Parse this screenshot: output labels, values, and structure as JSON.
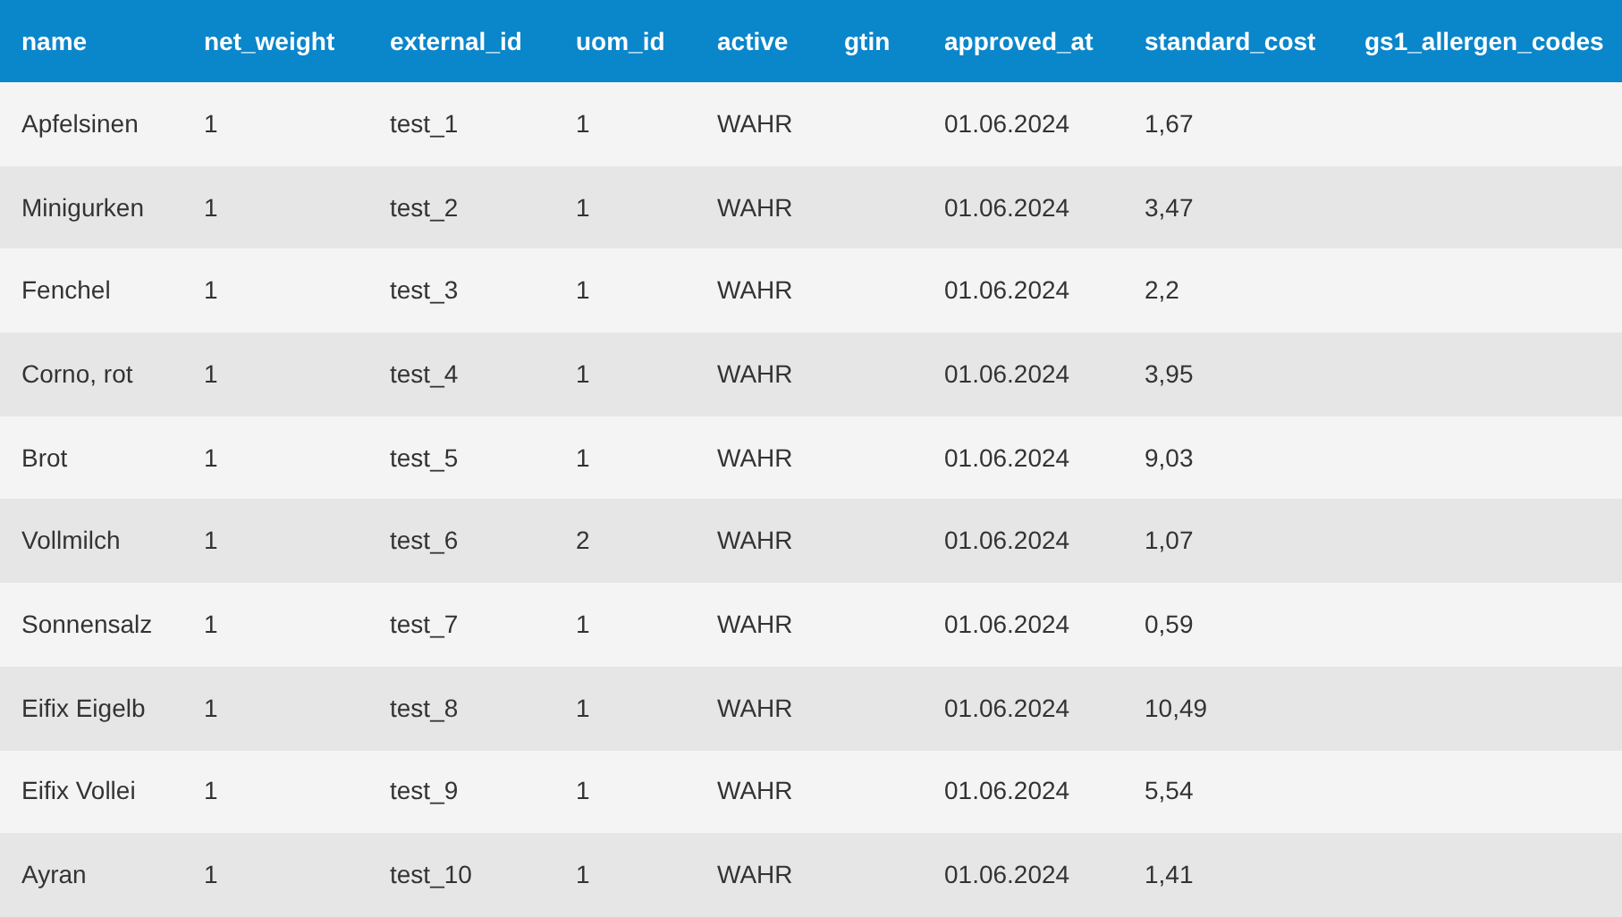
{
  "table": {
    "columns": [
      "name",
      "net_weight",
      "external_id",
      "uom_id",
      "active",
      "gtin",
      "approved_at",
      "standard_cost",
      "gs1_allergen_codes"
    ],
    "rows": [
      {
        "cells": [
          "Apfelsinen",
          "1",
          "test_1",
          "1",
          "WAHR",
          null,
          "01.06.2024",
          "1,67",
          null
        ]
      },
      {
        "cells": [
          "Minigurken",
          "1",
          "test_2",
          "1",
          "WAHR",
          null,
          "01.06.2024",
          "3,47",
          null
        ]
      },
      {
        "cells": [
          "Fenchel",
          "1",
          "test_3",
          "1",
          "WAHR",
          null,
          "01.06.2024",
          "2,2",
          null
        ]
      },
      {
        "cells": [
          "Corno, rot",
          "1",
          "test_4",
          "1",
          "WAHR",
          null,
          "01.06.2024",
          "3,95",
          null
        ]
      },
      {
        "cells": [
          "Brot",
          "1",
          "test_5",
          "1",
          "WAHR",
          null,
          "01.06.2024",
          "9,03",
          null
        ]
      },
      {
        "cells": [
          "Vollmilch",
          "1",
          "test_6",
          "2",
          "WAHR",
          null,
          "01.06.2024",
          "1,07",
          null
        ]
      },
      {
        "cells": [
          "Sonnensalz",
          "1",
          "test_7",
          "1",
          "WAHR",
          null,
          "01.06.2024",
          "0,59",
          null
        ]
      },
      {
        "cells": [
          "Eifix Eigelb",
          "1",
          "test_8",
          "1",
          "WAHR",
          null,
          "01.06.2024",
          "10,49",
          null
        ]
      },
      {
        "cells": [
          "Eifix Vollei",
          "1",
          "test_9",
          "1",
          "WAHR",
          null,
          "01.06.2024",
          "5,54",
          null
        ]
      },
      {
        "cells": [
          "Ayran",
          "1",
          "test_10",
          "1",
          "WAHR",
          null,
          "01.06.2024",
          "1,41",
          null
        ]
      }
    ]
  }
}
